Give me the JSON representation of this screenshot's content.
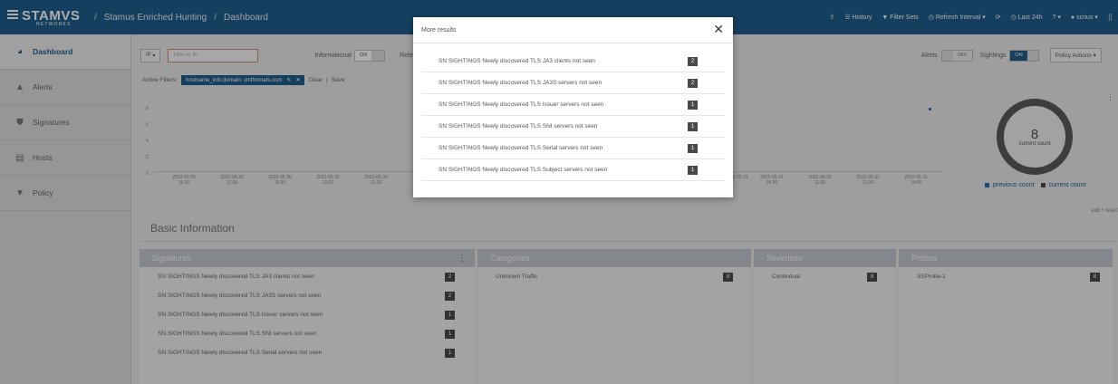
{
  "brand": {
    "name": "STAMVS",
    "sub": "NETWORKS"
  },
  "breadcrumb": [
    "Stamus Enriched Hunting",
    "Dashboard"
  ],
  "topbar": {
    "history": "History",
    "filter_sets": "Filter Sets",
    "refresh_interval": "Refresh Interval",
    "last_period": "Last 24h",
    "user": "scrius"
  },
  "sidebar": {
    "items": [
      {
        "label": "Dashboard",
        "icon": "dashboard-icon",
        "active": true
      },
      {
        "label": "Alerts",
        "icon": "bell-icon"
      },
      {
        "label": "Signatures",
        "icon": "shield-icon"
      },
      {
        "label": "Hosts",
        "icon": "hosts-icon"
      },
      {
        "label": "Policy",
        "icon": "filter-icon"
      }
    ]
  },
  "toolbar": {
    "field": "IP",
    "filter_placeholder": "Filter by IP",
    "informational_label": "Informational",
    "informational_state": "ON",
    "relevant_label": "Relevant",
    "alerts_label": "Alerts",
    "alerts_state": "OFF",
    "sightings_label": "Sightings",
    "sightings_state": "ON",
    "policy_actions": "Policy Actions"
  },
  "active_filters": {
    "label": "Active Filters:",
    "chip": "hostname_info.domain: xmlformats.com",
    "clear": "Clear",
    "save": "Save"
  },
  "chart_data": {
    "type": "line",
    "y_ticks": [
      "8",
      "6",
      "4",
      "2",
      "0"
    ],
    "x_ticks": [
      [
        "2022-05-30",
        "15:30"
      ],
      [
        "2022-05-30",
        "17:00"
      ],
      [
        "2022-05-30",
        "18:30"
      ],
      [
        "2022-05-30",
        "20:00"
      ],
      [
        "2022-05-30",
        "21:30"
      ],
      [
        "2022-05-31",
        ""
      ],
      [
        "2022-05-31",
        "09:30"
      ],
      [
        "2022-05-31",
        "11:00"
      ],
      [
        "2022-05-31",
        "12:30"
      ],
      [
        "2022-05-31",
        "14:00"
      ]
    ],
    "ylim": [
      0,
      8
    ],
    "legend": [
      "previous count",
      "current count"
    ]
  },
  "donut": {
    "value": "8",
    "label": "current count"
  },
  "edit_reset": "edit • reset",
  "basic_info_title": "Basic Information",
  "panels": {
    "signatures": {
      "title": "Signatures",
      "rows": [
        {
          "label": "SN SIGHTINGS Newly discovered TLS JA3 clients not seen",
          "count": "2"
        },
        {
          "label": "SN SIGHTINGS Newly discovered TLS JA3S servers not seen",
          "count": "2"
        },
        {
          "label": "SN SIGHTINGS Newly discovered TLS Issuer servers not seen",
          "count": "1"
        },
        {
          "label": "SN SIGHTINGS Newly discovered TLS SNI servers not seen",
          "count": "1"
        },
        {
          "label": "SN SIGHTINGS Newly discovered TLS Serial servers not seen",
          "count": "1"
        }
      ]
    },
    "categories": {
      "title": "Categories",
      "rows": [
        {
          "label": "Unknown Traffic",
          "count": "8"
        }
      ]
    },
    "severities": {
      "title": "Severities",
      "rows": [
        {
          "label": "Contextual",
          "count": "8"
        }
      ]
    },
    "probes": {
      "title": "Probes",
      "rows": [
        {
          "label": "SSProbe-1",
          "count": "8"
        }
      ]
    }
  },
  "modal": {
    "title": "More results",
    "rows": [
      {
        "label": "SN SIGHTINGS Newly discovered TLS JA3 clients not seen",
        "count": "2"
      },
      {
        "label": "SN SIGHTINGS Newly discovered TLS JA3S servers not seen",
        "count": "2"
      },
      {
        "label": "SN SIGHTINGS Newly discovered TLS Issuer servers not seen",
        "count": "1"
      },
      {
        "label": "SN SIGHTINGS Newly discovered TLS SNI servers not seen",
        "count": "1"
      },
      {
        "label": "SN SIGHTINGS Newly discovered TLS Serial servers not seen",
        "count": "1"
      },
      {
        "label": "SN SIGHTINGS Newly discovered TLS Subject servers not seen",
        "count": "1"
      }
    ]
  }
}
